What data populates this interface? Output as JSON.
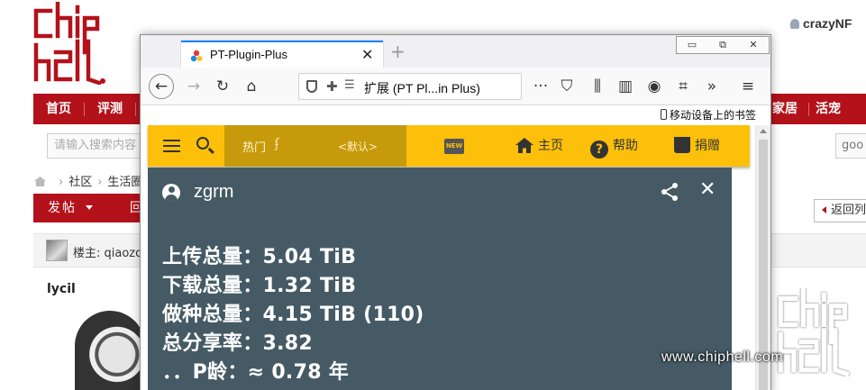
{
  "background_page": {
    "username": "crazyNF",
    "nav_items": [
      "首页",
      "评测",
      "家居",
      "活宠"
    ],
    "search_placeholder": "请输入搜索内容",
    "search_right_text": "goo",
    "breadcrumb": [
      "社区",
      "生活圈"
    ],
    "post_button": "发帖",
    "reply_button": "回",
    "back_button": "返回列",
    "op_label": "楼主: qiaozo",
    "author": "lycil",
    "watermark_text": "www.chiphell.com",
    "brand_color": "#b3121b"
  },
  "browser": {
    "tab_title": "PT-Plugin-Plus",
    "url_text": "扩展 (PT Pl...in Plus)",
    "bookmarks_label": "移动设备上的书签",
    "icons": [
      "back-arrow-icon",
      "forward-arrow-icon",
      "reload-icon",
      "home-icon",
      "shield-icon",
      "puzzle-icon",
      "more-icon",
      "pocket-icon",
      "library-icon",
      "sidebar-icon",
      "account-icon",
      "screenshot-icon",
      "overflow-icon",
      "menu-icon"
    ]
  },
  "plugin": {
    "header": {
      "search_hot": "热门",
      "search_default": "<默认>",
      "new_badge": "NEW",
      "nav": {
        "home": "主页",
        "help": "帮助",
        "donate": "捐赠"
      },
      "accent_color": "#fcc00a"
    },
    "card": {
      "username": "zgrm",
      "upload": "上传总量：5.04 TiB",
      "download": "下载总量：1.32 TiB",
      "seeding": "做种总量：4.15 TiB (110)",
      "ratio": "总分享率：3.82",
      "age": "．．P龄：≈ 0.78 年",
      "background_color": "#455a64"
    }
  }
}
